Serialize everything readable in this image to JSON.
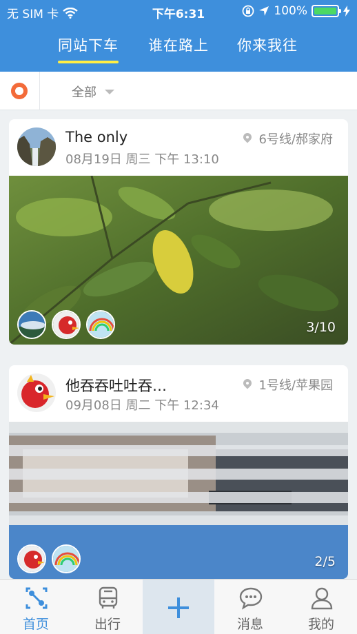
{
  "status_bar": {
    "carrier": "无 SIM 卡",
    "time": "下午6:31",
    "battery": "100%",
    "battery_level": 1.0
  },
  "top_tabs": [
    {
      "label": "同站下车",
      "active": true
    },
    {
      "label": "谁在路上",
      "active": false
    },
    {
      "label": "你来我往",
      "active": false
    }
  ],
  "filter": {
    "selected": "全部",
    "location_icon": "target-ring-icon"
  },
  "posts": [
    {
      "name": "The only",
      "date": "08月19日 周三 下午 13:10",
      "line": "6号线/郝家府",
      "photo_count": "3/10",
      "participants": 3
    },
    {
      "name": "他吞吞吐吐吞…",
      "date": "09月08日 周二 下午 12:34",
      "line": "1号线/苹果园",
      "photo_count": "2/5",
      "participants": 2
    }
  ],
  "bottom_tabs": [
    {
      "label": "首页",
      "icon": "home-nodes-icon",
      "active": true
    },
    {
      "label": "出行",
      "icon": "bus-icon",
      "active": false
    },
    {
      "label": "",
      "icon": "plus-icon",
      "active": false
    },
    {
      "label": "消息",
      "icon": "chat-bubble-icon",
      "active": false
    },
    {
      "label": "我的",
      "icon": "person-icon",
      "active": false
    }
  ],
  "colors": {
    "primary": "#3e8fdc",
    "tab_underline": "#ffee44",
    "accent_orange": "#f36b3a",
    "battery_green": "#4cd964"
  }
}
